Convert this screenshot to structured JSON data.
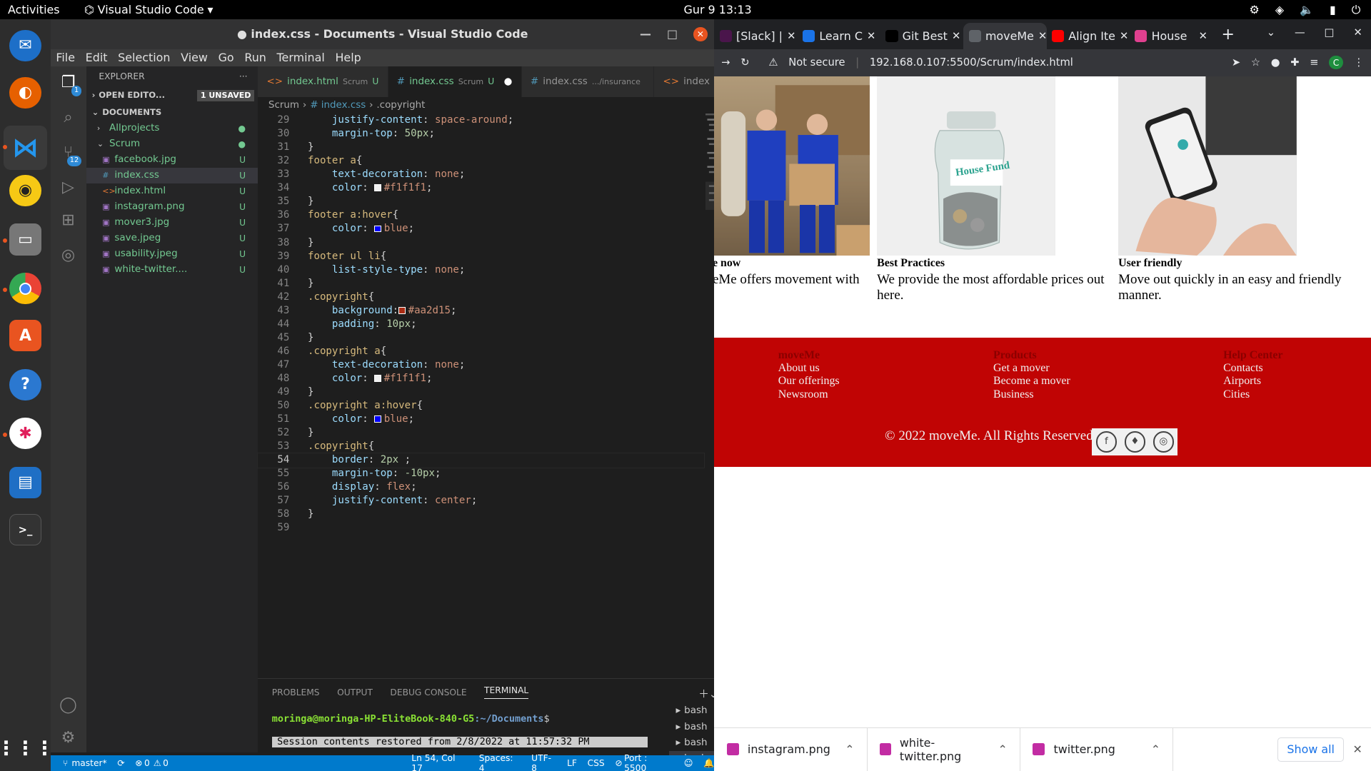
{
  "topbar": {
    "activities": "Activities",
    "app": "Visual Studio Code",
    "clock": "Gur 9  13:13"
  },
  "vscode": {
    "title": "● index.css - Documents - Visual Studio Code",
    "menu": [
      "File",
      "Edit",
      "Selection",
      "View",
      "Go",
      "Run",
      "Terminal",
      "Help"
    ],
    "explorer_label": "EXPLORER",
    "open_editors": "OPEN EDITO...",
    "unsaved": "1 UNSAVED",
    "documents": "DOCUMENTS",
    "tree": [
      {
        "name": "Allprojects",
        "type": "folder",
        "status": "●"
      },
      {
        "name": "Scrum",
        "type": "folder-open",
        "status": "●"
      },
      {
        "name": "facebook.jpg",
        "type": "img",
        "status": "U"
      },
      {
        "name": "index.css",
        "type": "css",
        "status": "U"
      },
      {
        "name": "index.html",
        "type": "html",
        "status": "U"
      },
      {
        "name": "instagram.png",
        "type": "img",
        "status": "U"
      },
      {
        "name": "mover3.jpg",
        "type": "img",
        "status": "U"
      },
      {
        "name": "save.jpeg",
        "type": "img",
        "status": "U"
      },
      {
        "name": "usability.jpeg",
        "type": "img",
        "status": "U"
      },
      {
        "name": "white-twitter....",
        "type": "img",
        "status": "U"
      }
    ],
    "tabs": [
      {
        "label": "index.html",
        "sub": "Scrum",
        "status": "U",
        "type": "html"
      },
      {
        "label": "index.css",
        "sub": "Scrum",
        "status": "U",
        "type": "css",
        "active": true
      },
      {
        "label": "index.css",
        "sub": ".../insurance",
        "status": "",
        "type": "css"
      },
      {
        "label": "index",
        "sub": "",
        "status": "",
        "type": "html"
      }
    ],
    "breadcrumb": [
      "Scrum",
      "# index.css",
      ".copyright"
    ],
    "code": [
      {
        "n": 29,
        "t": [
          [
            "    ",
            ""
          ],
          [
            "justify-content",
            "prop"
          ],
          [
            ": ",
            "pun"
          ],
          [
            "space-around",
            "val"
          ],
          [
            ";",
            "pun"
          ]
        ]
      },
      {
        "n": 30,
        "t": [
          [
            "    ",
            ""
          ],
          [
            "margin-top",
            "prop"
          ],
          [
            ": ",
            "pun"
          ],
          [
            "50px",
            "num"
          ],
          [
            ";",
            "pun"
          ]
        ]
      },
      {
        "n": 31,
        "t": [
          [
            "}",
            "pun"
          ]
        ]
      },
      {
        "n": 32,
        "t": [
          [
            "footer a",
            "sel"
          ],
          [
            "{",
            "pun"
          ]
        ]
      },
      {
        "n": 33,
        "t": [
          [
            "    ",
            ""
          ],
          [
            "text-decoration",
            "prop"
          ],
          [
            ": ",
            "pun"
          ],
          [
            "none",
            "val"
          ],
          [
            ";",
            "pun"
          ]
        ]
      },
      {
        "n": 34,
        "t": [
          [
            "    ",
            ""
          ],
          [
            "color",
            "prop"
          ],
          [
            ": ",
            "pun"
          ],
          [
            "#f1f1f1",
            "val",
            "#f1f1f1"
          ],
          [
            ";",
            "pun"
          ]
        ]
      },
      {
        "n": 35,
        "t": [
          [
            "}",
            "pun"
          ]
        ]
      },
      {
        "n": 36,
        "t": [
          [
            "footer a:hover",
            "sel"
          ],
          [
            "{",
            "pun"
          ]
        ]
      },
      {
        "n": 37,
        "t": [
          [
            "    ",
            ""
          ],
          [
            "color",
            "prop"
          ],
          [
            ": ",
            "pun"
          ],
          [
            "blue",
            "val",
            "#0000ff"
          ],
          [
            ";",
            "pun"
          ]
        ]
      },
      {
        "n": 38,
        "t": [
          [
            "}",
            "pun"
          ]
        ]
      },
      {
        "n": 39,
        "t": [
          [
            "footer ul li",
            "sel"
          ],
          [
            "{",
            "pun"
          ]
        ]
      },
      {
        "n": 40,
        "t": [
          [
            "    ",
            ""
          ],
          [
            "list-style-type",
            "prop"
          ],
          [
            ": ",
            "pun"
          ],
          [
            "none",
            "val"
          ],
          [
            ";",
            "pun"
          ]
        ]
      },
      {
        "n": 41,
        "t": [
          [
            "}",
            "pun"
          ]
        ]
      },
      {
        "n": 42,
        "t": [
          [
            ".copyright",
            "sel"
          ],
          [
            "{",
            "pun"
          ]
        ]
      },
      {
        "n": 43,
        "t": [
          [
            "    ",
            ""
          ],
          [
            "background",
            "prop"
          ],
          [
            ":",
            "pun"
          ],
          [
            "#aa2d15",
            "val",
            "#aa2d15"
          ],
          [
            ";",
            "pun"
          ]
        ]
      },
      {
        "n": 44,
        "t": [
          [
            "    ",
            ""
          ],
          [
            "padding",
            "prop"
          ],
          [
            ": ",
            "pun"
          ],
          [
            "10px",
            "num"
          ],
          [
            ";",
            "pun"
          ]
        ]
      },
      {
        "n": 45,
        "t": [
          [
            "}",
            "pun"
          ]
        ]
      },
      {
        "n": 46,
        "t": [
          [
            ".copyright a",
            "sel"
          ],
          [
            "{",
            "pun"
          ]
        ]
      },
      {
        "n": 47,
        "t": [
          [
            "    ",
            ""
          ],
          [
            "text-decoration",
            "prop"
          ],
          [
            ": ",
            "pun"
          ],
          [
            "none",
            "val"
          ],
          [
            ";",
            "pun"
          ]
        ]
      },
      {
        "n": 48,
        "t": [
          [
            "    ",
            ""
          ],
          [
            "color",
            "prop"
          ],
          [
            ": ",
            "pun"
          ],
          [
            "#f1f1f1",
            "val",
            "#f1f1f1"
          ],
          [
            ";",
            "pun"
          ]
        ]
      },
      {
        "n": 49,
        "t": [
          [
            "}",
            "pun"
          ]
        ]
      },
      {
        "n": 50,
        "t": [
          [
            ".copyright a:hover",
            "sel"
          ],
          [
            "{",
            "pun"
          ]
        ]
      },
      {
        "n": 51,
        "t": [
          [
            "    ",
            ""
          ],
          [
            "color",
            "prop"
          ],
          [
            ": ",
            "pun"
          ],
          [
            "blue",
            "val",
            "#0000ff"
          ],
          [
            ";",
            "pun"
          ]
        ]
      },
      {
        "n": 52,
        "t": [
          [
            "}",
            "pun"
          ]
        ]
      },
      {
        "n": 53,
        "t": [
          [
            ".copyright",
            "sel"
          ],
          [
            "{",
            "pun"
          ]
        ]
      },
      {
        "n": 54,
        "t": [
          [
            "    ",
            ""
          ],
          [
            "border",
            "prop"
          ],
          [
            ": ",
            "pun"
          ],
          [
            "2px",
            "num"
          ],
          [
            " ;",
            "pun"
          ]
        ],
        "cur": true
      },
      {
        "n": 55,
        "t": [
          [
            "    ",
            ""
          ],
          [
            "margin-top",
            "prop"
          ],
          [
            ": ",
            "pun"
          ],
          [
            "-10px",
            "num"
          ],
          [
            ";",
            "pun"
          ]
        ]
      },
      {
        "n": 56,
        "t": [
          [
            "    ",
            ""
          ],
          [
            "display",
            "prop"
          ],
          [
            ": ",
            "pun"
          ],
          [
            "flex",
            "val"
          ],
          [
            ";",
            "pun"
          ]
        ]
      },
      {
        "n": 57,
        "t": [
          [
            "    ",
            ""
          ],
          [
            "justify-content",
            "prop"
          ],
          [
            ": ",
            "pun"
          ],
          [
            "center",
            "val"
          ],
          [
            ";",
            "pun"
          ]
        ]
      },
      {
        "n": 58,
        "t": [
          [
            "}",
            "pun"
          ]
        ]
      },
      {
        "n": 59,
        "t": []
      }
    ],
    "panel_tabs": [
      "PROBLEMS",
      "OUTPUT",
      "DEBUG CONSOLE",
      "TERMINAL"
    ],
    "terminal": {
      "prompt_user": "moringa@moringa-HP-EliteBook-840-G5",
      "prompt_path": ":~/Documents",
      "prompt_end": "$",
      "restored": "Session contents restored from 2/8/2022 at 11:57:32 PM"
    },
    "term_list": [
      "bash",
      "bash",
      "bash",
      "bash"
    ],
    "status": {
      "branch": "master*",
      "errors": "0",
      "warnings": "0",
      "position": "Ln 54, Col 17",
      "spaces": "Spaces: 4",
      "encoding": "UTF-8",
      "eol": "LF",
      "lang": "CSS",
      "port": "Port : 5500"
    }
  },
  "chrome": {
    "tabs": [
      {
        "label": "[Slack] |",
        "icon_color": "#4a154b"
      },
      {
        "label": "Learn C",
        "icon_color": "#1a73e8"
      },
      {
        "label": "Git Best",
        "icon_color": "#000000"
      },
      {
        "label": "moveMe",
        "icon_color": "#5f6368",
        "active": true
      },
      {
        "label": "Align Ite",
        "icon_color": "#ff0000"
      },
      {
        "label": "House",
        "icon_color": "#e0408f"
      }
    ],
    "not_secure": "Not secure",
    "url": "192.168.0.107:5500/Scrum/index.html",
    "page": {
      "cards": [
        {
          "title": "e now",
          "desc": "eMe offers movement with"
        },
        {
          "title": "Best Practices",
          "desc": "We provide the most affordable prices out here."
        },
        {
          "title": "User friendly",
          "desc": "Move out quickly in an easy and friendly manner."
        }
      ],
      "jar_label": "House Fund",
      "footer": [
        {
          "head": "moveMe",
          "links": [
            "About us",
            "Our offerings",
            "Newsroom"
          ]
        },
        {
          "head": "Products",
          "links": [
            "Get a mover",
            "Become a mover",
            "Business"
          ]
        },
        {
          "head": "Help Center",
          "links": [
            "Contacts",
            "Airports",
            "Cities"
          ]
        }
      ],
      "copyright": "© 2022 moveMe. All Rights Reserved"
    },
    "downloads": [
      "instagram.png",
      "white-twitter.png",
      "twitter.png"
    ],
    "show_all": "Show all"
  }
}
